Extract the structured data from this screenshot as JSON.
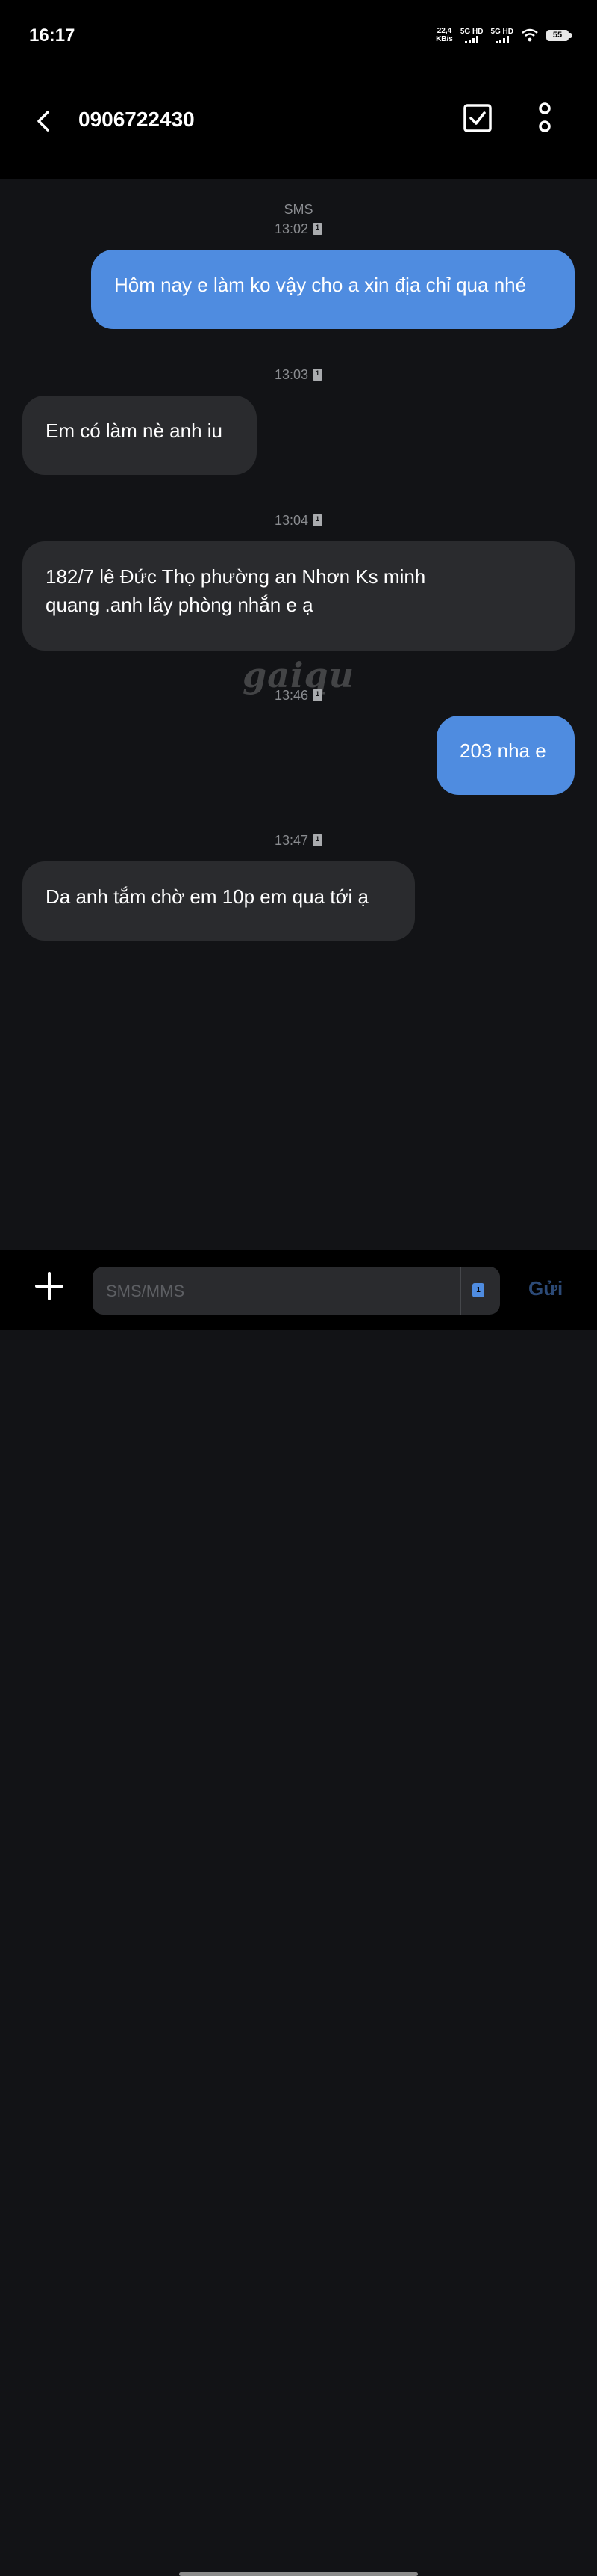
{
  "status_bar": {
    "time": "16:17",
    "speed_value": "22,4",
    "speed_unit": "KB/s",
    "sim1_label": "5G HD",
    "sim2_label": "5G HD",
    "battery": "55"
  },
  "header": {
    "title": "0906722430",
    "back_icon": "chevron-left-icon",
    "select_icon": "checkbox-icon",
    "more_icon": "more-vertical-icon"
  },
  "conversation": {
    "label": "SMS",
    "watermark": "gaiqu",
    "messages": [
      {
        "time": "13:02",
        "direction": "outgoing",
        "text": "Hôm nay e làm ko vậy cho a xin địa chỉ qua nhé"
      },
      {
        "time": "13:03",
        "direction": "incoming",
        "text": "Em có làm nè anh iu"
      },
      {
        "time": "13:04",
        "direction": "incoming",
        "text_line1": "182/7 lê Đức Thọ phường an Nhơn Ks minh",
        "text_line2": "quang .anh lấy phòng nhắn e ạ"
      },
      {
        "time": "13:46",
        "direction": "outgoing",
        "text": "203 nha e"
      },
      {
        "time": "13:47",
        "direction": "incoming",
        "text": "Da anh tắm chờ em 10p em qua tới ạ"
      }
    ]
  },
  "composer": {
    "placeholder": "SMS/MMS",
    "sim_chip": "1",
    "send_label": "Gửi",
    "add_icon": "plus-icon"
  },
  "colors": {
    "outgoing_bubble": "#4f8ce0",
    "incoming_bubble": "#2a2b2e",
    "background": "#121316",
    "send_disabled": "#2c4a77"
  }
}
